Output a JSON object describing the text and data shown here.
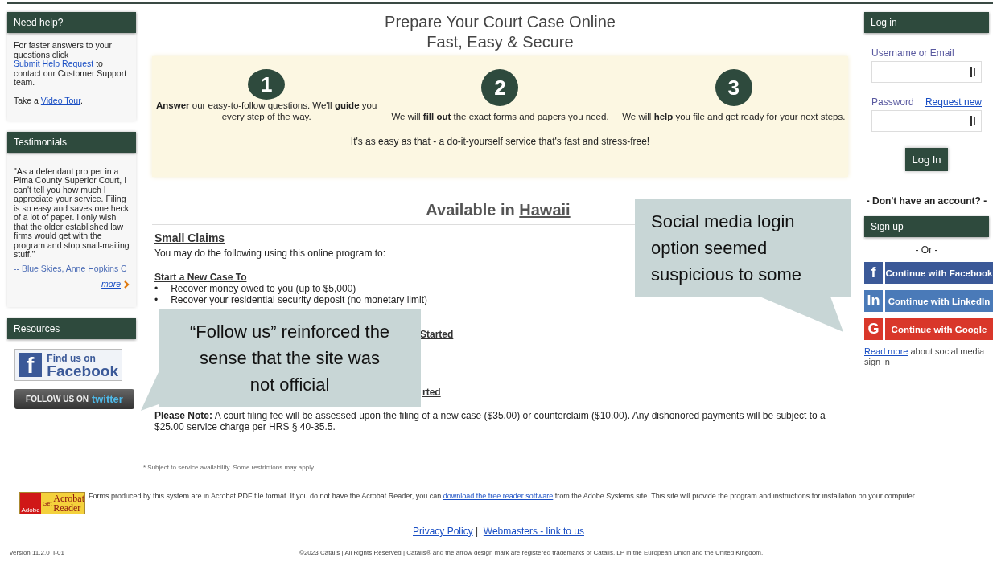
{
  "help": {
    "title": "Need help?",
    "parts": [
      {
        "text": "For faster answers to your questions click "
      },
      {
        "link": "Submit Help Request"
      },
      {
        "text": " to contact our Customer Support team."
      }
    ],
    "tour": [
      {
        "text": "Take a "
      },
      {
        "link": "Video Tour"
      },
      {
        "text": "."
      }
    ]
  },
  "testimonials": {
    "title": "Testimonials",
    "quote": "\"As a defendant pro per in a Pima County Superior Court, I can't tell you how much I appreciate your service. Filing is so easy and saves one heck of a lot of paper. I only wish that the older established law firms would get with the program and stop snail-mailing stuff.\"",
    "author": "-- Blue Skies, Anne Hopkins C",
    "more": "more"
  },
  "resources": {
    "title": "Resources",
    "badges": [
      {
        "kind": "facebook",
        "glyph": "f",
        "small": "Find us on",
        "big": "Facebook"
      },
      {
        "kind": "twitter",
        "small": "FOLLOW US ON",
        "big": "twitter"
      }
    ]
  },
  "header": {
    "title": "Prepare Your Court Case Online",
    "subtitle": "Fast, Easy & Secure"
  },
  "steps": [
    {
      "number": "1",
      "text": "**Answer** our easy-to-follow questions. We'll **guide** you every step of the way."
    },
    {
      "number": "2",
      "text": "We will **fill out** the exact forms and papers you need."
    },
    {
      "number": "3",
      "text": "We will **help** you file and get ready for your next steps."
    }
  ],
  "tagline": "It's as easy as that - a do-it-yourself service that's fast and stress-free!",
  "availability": {
    "text": "Available in ",
    "link": "Hawaii"
  },
  "section": {
    "title": "Small Claims",
    "intro": "You may do the following using this online program to:",
    "groups": [
      {
        "kind": "full",
        "heading": "Start a New Case To",
        "bullet": "•",
        "items": [
          "Recover money owed to you (up to $5,000)",
          "Recover your residential security deposit (no monetary limit)"
        ]
      },
      {
        "kind": "covered",
        "heading": "Started"
      },
      {
        "kind": "covered",
        "heading": "rted"
      }
    ],
    "note": "**Please Note:** A court filing fee will be assessed upon the filing of a new case ($35.00) or counterclaim ($10.00). Any dishonored payments will be subject to a $25.00 service charge per HRS § 40-35.5."
  },
  "login": {
    "title": "Log in",
    "username_label": "Username or Email",
    "password_label": "Password",
    "request_link": "Request new",
    "button": "Log In",
    "no_account": "- Don't have an account? -",
    "signup_title": "Sign up",
    "or": "- Or -",
    "socials": [
      {
        "kind": "facebook",
        "glyph": "f",
        "label": "Continue with Facebook"
      },
      {
        "kind": "linkedin",
        "glyph": "in",
        "label": "Continue with LinkedIn"
      },
      {
        "kind": "google",
        "glyph": "G",
        "label": "Continue with Google"
      }
    ],
    "read_more": [
      {
        "link": "Read more"
      },
      {
        "text": " about social media sign in"
      }
    ]
  },
  "footer": {
    "note": "* Subject to service availability. Some restrictions may apply.",
    "acrobat": {
      "get": "Get",
      "name": "Acrobat",
      "reader": "Reader",
      "maker": "Adobe"
    },
    "forms": [
      {
        "text": "Forms produced by this system are in Acrobat PDF file format. If you do not have the Acrobat Reader, you can "
      },
      {
        "link": "download the free reader software"
      },
      {
        "text": " from the Adobe Systems site. This site will provide the program and instructions for installation on your computer."
      }
    ],
    "links": [
      "Privacy Policy",
      "Webmasters - link to us"
    ],
    "separator": "|",
    "version": "version 11.2.0  I-01",
    "copyright": "©2023 Catalis | All Rights Reserved | Catalis® and the arrow design mark are registered trademarks of Catalis, LP in the European Union and the United Kingdom."
  },
  "callouts": [
    {
      "text": "“Follow us” reinforced the\nsense that the site was\nnot official"
    },
    {
      "text": "Social media login\noption seemed\nsuspicious to some"
    }
  ]
}
